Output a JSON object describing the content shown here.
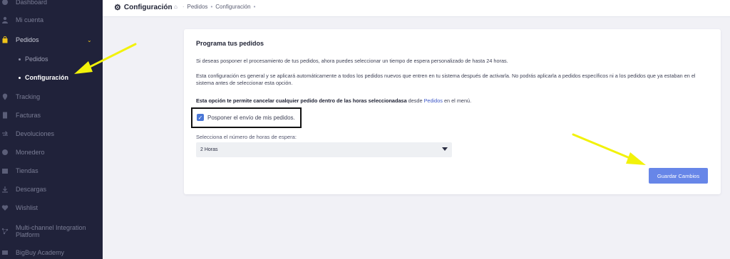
{
  "colors": {
    "sidebar_bg": "#20223a",
    "accent": "#6786e8",
    "arrow": "#f2f20a",
    "link": "#3d57c7"
  },
  "sidebar": {
    "items": [
      {
        "label": "Dashboard",
        "icon": "dashboard-icon"
      },
      {
        "label": "Mi cuenta",
        "icon": "user-icon"
      },
      {
        "label": "Pedidos",
        "icon": "bag-icon",
        "chevron": "⌄"
      },
      {
        "label": "Tracking",
        "icon": "location-icon"
      },
      {
        "label": "Facturas",
        "icon": "invoice-icon"
      },
      {
        "label": "Devoluciones",
        "icon": "return-icon"
      },
      {
        "label": "Monedero",
        "icon": "wallet-icon"
      },
      {
        "label": "Tiendas",
        "icon": "store-icon"
      },
      {
        "label": "Descargas",
        "icon": "download-icon"
      },
      {
        "label": "Wishlist",
        "icon": "heart-icon"
      },
      {
        "label": "Multi-channel Integration Platform",
        "icon": "integration-icon"
      },
      {
        "label": "BigBuy Academy",
        "icon": "academy-icon"
      }
    ],
    "sub_items": [
      {
        "label": "Pedidos"
      },
      {
        "label": "Configuración"
      }
    ]
  },
  "header": {
    "title": "Configuración",
    "breadcrumb": [
      "Pedidos",
      "Configuración"
    ]
  },
  "card": {
    "title": "Programa tus pedidos",
    "para1": "Si deseas posponer el procesamiento de tus pedidos, ahora puedes seleccionar un tiempo de espera personalizado de hasta 24 horas.",
    "para2": "Esta configuración es general y se aplicará automáticamente a todos los pedidos nuevos que entren en tu sistema después de activarla. No podrás aplicarla a pedidos específicos ni a los pedidos que ya estaban en el sistema antes de seleccionar esta opción.",
    "para3_bold": "Esta opción te permite cancelar cualquier pedido dentro de las horas seleccionadasa",
    "para3_mid": " desde ",
    "para3_link": "Pedidos",
    "para3_end": " en el menú.",
    "checkbox_label": "Posponer el envío de mis pedidos.",
    "checkbox_checked": true,
    "select_label": "Selecciona el número de horas de espera:",
    "select_value": "2 Horas",
    "save_label": "Guardar Cambios"
  }
}
